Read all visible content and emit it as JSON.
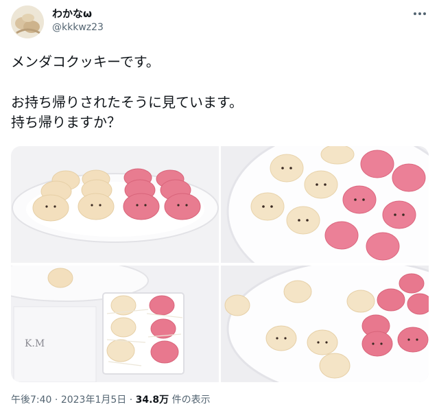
{
  "user": {
    "display_name": "わかなω",
    "handle": "@kkkwz23",
    "avatar": "avatar-image"
  },
  "tweet": {
    "paragraph_1": "メンダコクッキーです。",
    "paragraph_2": "お持ち帰りされたそうに見ています。\n持ち帰りますか？"
  },
  "media": {
    "photos": [
      "photo-cookies-plate-rows",
      "photo-cookies-plate-closeup",
      "photo-cookies-gift-box",
      "photo-cookies-plate-mixed"
    ],
    "box_label": "K.M"
  },
  "meta": {
    "time": "午後7:40",
    "separator": "·",
    "date": "2023年1月5日",
    "views_count": "34.8万",
    "views_label": "件の表示"
  },
  "icons": {
    "more": "more-dots-icon"
  },
  "colors": {
    "text": "#0f1419",
    "secondary": "#536471",
    "cookie_cream": "#f5e3c3",
    "cookie_pink": "#e8738a"
  }
}
